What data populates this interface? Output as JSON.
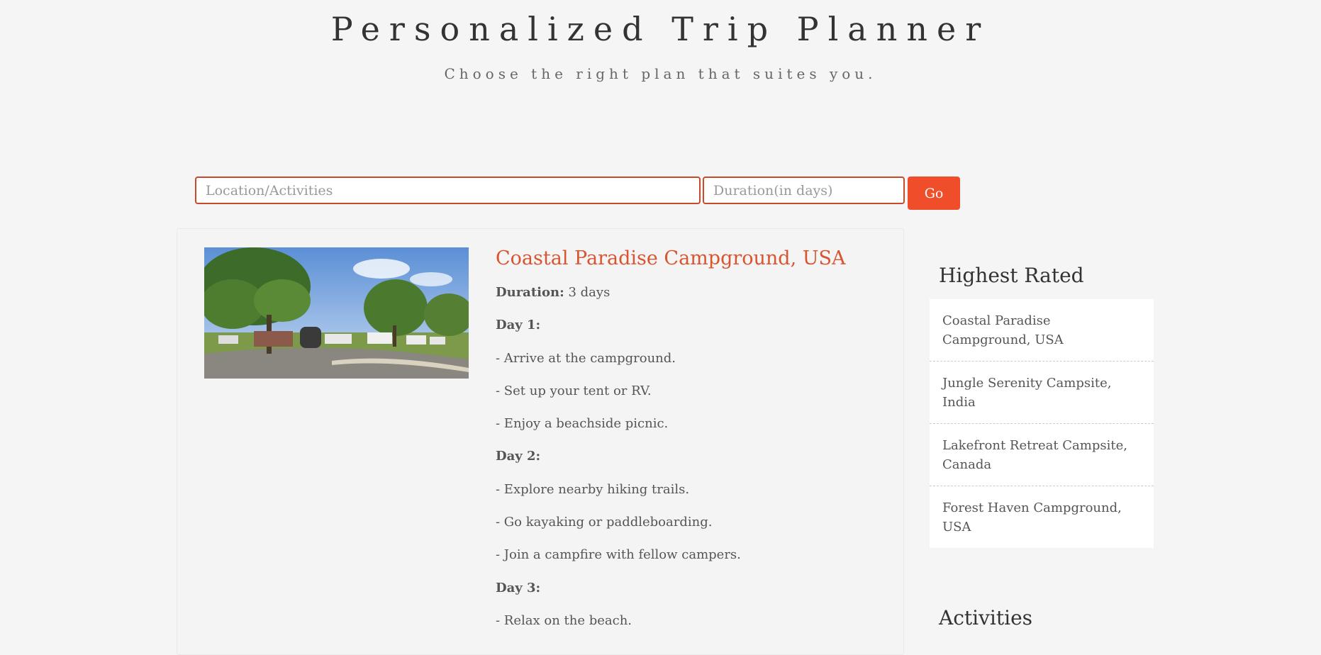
{
  "header": {
    "title": "Personalized Trip Planner",
    "subtitle": "Choose the right plan that suites you."
  },
  "search": {
    "location_placeholder": "Location/Activities",
    "duration_placeholder": "Duration(in days)",
    "go_label": "Go"
  },
  "result": {
    "title": "Coastal Paradise Campground, USA",
    "duration_label": "Duration:",
    "duration_value": "3 days",
    "day1_label": "Day 1:",
    "day1_items": [
      "- Arrive at the campground.",
      "- Set up your tent or RV.",
      "- Enjoy a beachside picnic."
    ],
    "day2_label": "Day 2:",
    "day2_items": [
      "- Explore nearby hiking trails.",
      "- Go kayaking or paddleboarding.",
      "- Join a campfire with fellow campers."
    ],
    "day3_label": "Day 3:",
    "day3_items": [
      "- Relax on the beach."
    ]
  },
  "sidebar": {
    "highest_rated_heading": "Highest Rated",
    "highest_rated": [
      "Coastal Paradise Campground, USA",
      "Jungle Serenity Campsite, India",
      "Lakefront Retreat Campsite, Canada",
      "Forest Haven Campground, USA"
    ],
    "activities_heading": "Activities"
  },
  "colors": {
    "accent": "#f04e2a",
    "title_accent": "#d9542f",
    "input_border": "#c84a2b",
    "background": "#f5f5f5"
  },
  "icons": {
    "photo": "campground-photo"
  }
}
